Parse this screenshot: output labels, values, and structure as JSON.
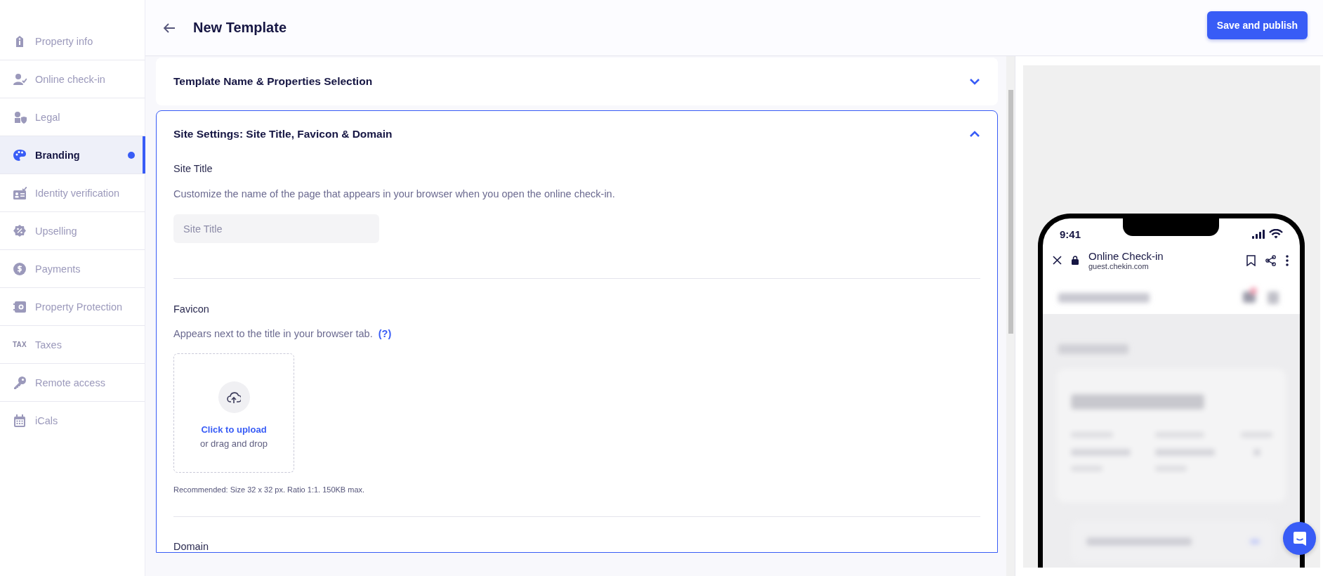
{
  "sidebar": {
    "items": [
      {
        "label": "Property info",
        "selected": false,
        "unsaved": false
      },
      {
        "label": "Online check-in",
        "selected": false,
        "unsaved": false
      },
      {
        "label": "Legal",
        "selected": false,
        "unsaved": false
      },
      {
        "label": "Branding",
        "selected": true,
        "unsaved": true
      },
      {
        "label": "Identity verification",
        "selected": false,
        "unsaved": false
      },
      {
        "label": "Upselling",
        "selected": false,
        "unsaved": false
      },
      {
        "label": "Payments",
        "selected": false,
        "unsaved": false
      },
      {
        "label": "Property Protection",
        "selected": false,
        "unsaved": false
      },
      {
        "label": "Taxes",
        "icon_text": "TAX",
        "selected": false,
        "unsaved": false
      },
      {
        "label": "Remote access",
        "selected": false,
        "unsaved": false
      },
      {
        "label": "iCals",
        "selected": false,
        "unsaved": false
      }
    ]
  },
  "header": {
    "title": "New Template",
    "publish_button": "Save and publish"
  },
  "sections": [
    {
      "title": "Template Name & Properties Selection",
      "expanded": false
    },
    {
      "title": "Site Settings: Site Title, Favicon & Domain",
      "expanded": true,
      "site_title": {
        "label": "Site Title",
        "description": "Customize the name of the page that appears in your browser when you open the online check-in.",
        "placeholder": "Site Title"
      },
      "favicon": {
        "label": "Favicon",
        "description": "Appears next to the title in your browser tab.",
        "help": "(?)",
        "upload_link": "Click to upload",
        "upload_hint": "or drag and drop",
        "note": "Recommended: Size 32 x 32 px. Ratio 1:1. 150KB max."
      },
      "domain": {
        "label": "Domain"
      }
    }
  ],
  "preview": {
    "time": "9:41",
    "page_title": "Online Check-in",
    "url": "guest.chekin.com"
  }
}
